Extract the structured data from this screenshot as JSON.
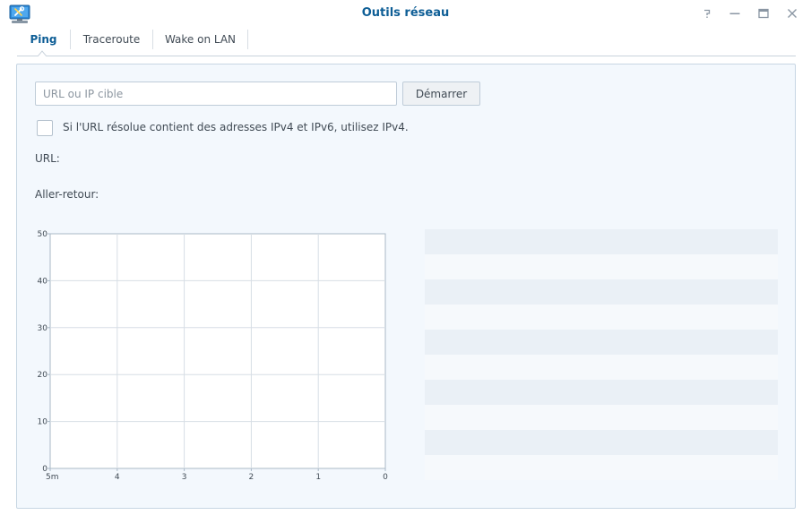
{
  "window": {
    "title": "Outils réseau",
    "icons": {
      "app": "network-tools-icon",
      "help": "help-icon",
      "minimize": "minimize-icon",
      "maximize": "maximize-icon",
      "close": "close-icon"
    },
    "accent_color": "#0e5e96"
  },
  "tabs": [
    {
      "label": "Ping",
      "active": true
    },
    {
      "label": "Traceroute",
      "active": false
    },
    {
      "label": "Wake on LAN",
      "active": false
    }
  ],
  "ping": {
    "target_input": {
      "value": "",
      "placeholder": "URL ou IP cible"
    },
    "start_label": "Démarrer",
    "ipv4_checkbox": {
      "label": "Si l'URL résolue contient des adresses IPv4 et IPv6, utilisez IPv4.",
      "checked": false
    },
    "url_label": "URL:",
    "roundtrip_label": "Aller-retour:"
  },
  "chart_data": {
    "type": "line",
    "title": "",
    "xlabel": "",
    "ylabel": "",
    "x_ticks": [
      "5m",
      "4",
      "3",
      "2",
      "1",
      "0"
    ],
    "y_ticks": [
      "0",
      "10",
      "20",
      "30",
      "40",
      "50"
    ],
    "ylim": [
      0,
      50
    ],
    "grid": true,
    "series": []
  },
  "results": {
    "rows": [
      "",
      "",
      "",
      "",
      "",
      "",
      "",
      "",
      "",
      ""
    ]
  }
}
